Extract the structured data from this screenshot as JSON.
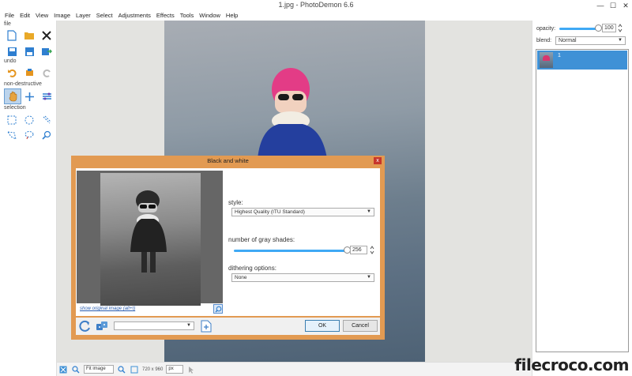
{
  "window": {
    "title": "1.jpg - PhotoDemon 6.6",
    "minimize": "—",
    "maximize": "☐",
    "close": "✕"
  },
  "menu": [
    "File",
    "Edit",
    "View",
    "Image",
    "Layer",
    "Select",
    "Adjustments",
    "Effects",
    "Tools",
    "Window",
    "Help"
  ],
  "toolbox": {
    "sections": {
      "file": "file",
      "undo": "undo",
      "nondestructive": "non-destructive",
      "selection": "selection"
    }
  },
  "status": {
    "zoom": "Fit image",
    "size": "720 x 960",
    "unit": "px"
  },
  "right_panel": {
    "opacity_label": "opacity:",
    "opacity_value": "100",
    "opacity": 1.0,
    "blend_label": "blend:",
    "blend_value": "Normal",
    "layer_name": "1"
  },
  "dialog": {
    "title": "Black and white",
    "close": "x",
    "show_original": "show original image (alt+t)",
    "style_label": "style:",
    "style_value": "Highest Quality (ITU Standard)",
    "shades_label": "number of gray shades:",
    "shades_value": "256",
    "shades_fraction": 1.0,
    "dither_label": "dithering options:",
    "dither_value": "None",
    "ok": "OK",
    "cancel": "Cancel"
  },
  "watermark": "filecroco.com",
  "colors": {
    "accent": "#3fa9f5",
    "selection": "#3f91d6",
    "dialog_frame": "#e29a52"
  }
}
